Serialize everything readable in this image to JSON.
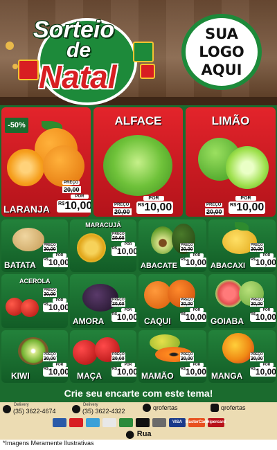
{
  "header": {
    "title_line1": "Sorteio",
    "title_line2": "de",
    "title_line3": "Natal",
    "logo_lines": [
      "SUA",
      "LOGO",
      "AQUI"
    ]
  },
  "big_cards": [
    {
      "name": "LARANJA",
      "badge": "-50%",
      "preco": "PREÇO",
      "old": "20,00",
      "por": "POR",
      "currency": "R$",
      "price": "10,00",
      "bg": "#d81e22"
    },
    {
      "name": "ALFACE",
      "preco": "PREÇO",
      "old": "20,00",
      "por": "POR",
      "currency": "R$",
      "price": "10,00",
      "bg": "#d81e22"
    },
    {
      "name": "LIMÃO",
      "preco": "PREÇO",
      "old": "20,00",
      "por": "POR",
      "currency": "R$",
      "price": "10,00",
      "bg": "#d81e22"
    }
  ],
  "small_cards": [
    {
      "name": "BATATA",
      "preco": "PREÇO",
      "old": "20,00",
      "por": "POR",
      "currency": "R$",
      "price": "10,00"
    },
    {
      "name": "MARACUJÁ",
      "preco": "PREÇO",
      "old": "20,00",
      "por": "POR",
      "currency": "R$",
      "price": "10,00"
    },
    {
      "name": "ABACATE",
      "preco": "PREÇO",
      "old": "20,00",
      "por": "POR",
      "currency": "R$",
      "price": "10,00"
    },
    {
      "name": "ABACAXI",
      "preco": "PREÇO",
      "old": "20,00",
      "por": "POR",
      "currency": "R$",
      "price": "10,00"
    },
    {
      "name": "ACEROLA",
      "preco": "PREÇO",
      "old": "20,00",
      "por": "POR",
      "currency": "R$",
      "price": "10,00"
    },
    {
      "name": "AMORA",
      "preco": "PREÇO",
      "old": "20,00",
      "por": "POR",
      "currency": "R$",
      "price": "10,00"
    },
    {
      "name": "CAQUI",
      "preco": "PREÇO",
      "old": "20,00",
      "por": "POR",
      "currency": "R$",
      "price": "10,00"
    },
    {
      "name": "GOIABA",
      "preco": "PREÇO",
      "old": "20,00",
      "por": "POR",
      "currency": "R$",
      "price": "10,00"
    },
    {
      "name": "KIWI",
      "preco": "PREÇO",
      "old": "20,00",
      "por": "POR",
      "currency": "R$",
      "price": "10,00"
    },
    {
      "name": "MAÇA",
      "preco": "PREÇO",
      "old": "20,00",
      "por": "POR",
      "currency": "R$",
      "price": "10,00"
    },
    {
      "name": "MAMÃO",
      "preco": "PREÇO",
      "old": "20,00",
      "por": "POR",
      "currency": "R$",
      "price": "10,00"
    },
    {
      "name": "MANGA",
      "preco": "PREÇO",
      "old": "20,00",
      "por": "POR",
      "currency": "R$",
      "price": "10,00"
    }
  ],
  "banner": "Crie seu encarte com este tema!",
  "contact": {
    "delivery_label": "Delivery",
    "phone1": "(35) 3622-4674",
    "phone2": "(35) 3622-4322",
    "facebook": "qrofertas",
    "instagram": "qrofertas"
  },
  "payments": [
    "VISA",
    "MasterCard",
    "Hipercard"
  ],
  "address": "Rua",
  "footnote": "*Imagens Meramente Ilustrativas",
  "colors": {
    "red": "#d81e22",
    "green": "#1b6b2e",
    "cream": "#ecdcb3"
  }
}
